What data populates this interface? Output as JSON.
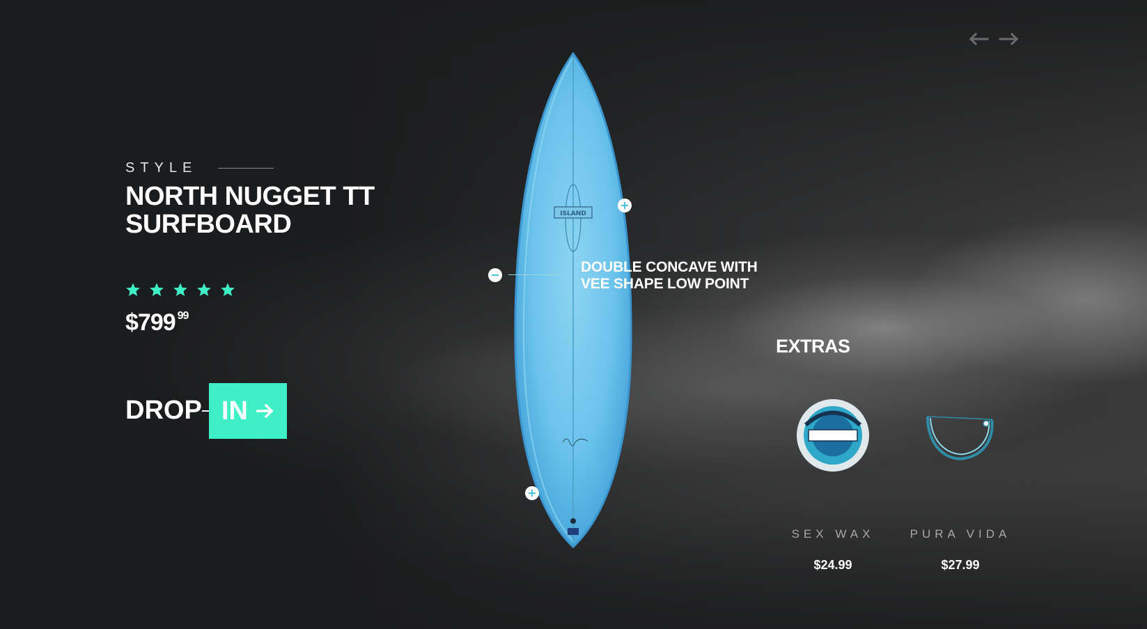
{
  "product": {
    "style_label": "STYLE",
    "title": "NORTH NUGGET TT SURFBOARD",
    "rating_stars": 5,
    "price_main": "$799",
    "price_cents": "99"
  },
  "cta": {
    "drop_label": "DROP",
    "in_label": "IN"
  },
  "board": {
    "annotation": "DOUBLE CONCAVE WITH VEE SHAPE LOW POINT"
  },
  "extras": {
    "title": "EXTRAS",
    "items": [
      {
        "name": "SEX WAX",
        "price": "$24.99",
        "image": "sex-wax-puck"
      },
      {
        "name": "PURA VIDA",
        "price": "$27.99",
        "image": "pura-vida-bracelet"
      }
    ]
  },
  "colors": {
    "accent": "#3ff0c6",
    "board": "#5bb8e8",
    "background": "#1b1c1d"
  },
  "icons": {
    "prev": "arrow-left-icon",
    "next": "arrow-right-icon",
    "star": "star-icon",
    "hotspot_plus": "plus-circle-icon",
    "hotspot_minus": "minus-circle-icon"
  }
}
